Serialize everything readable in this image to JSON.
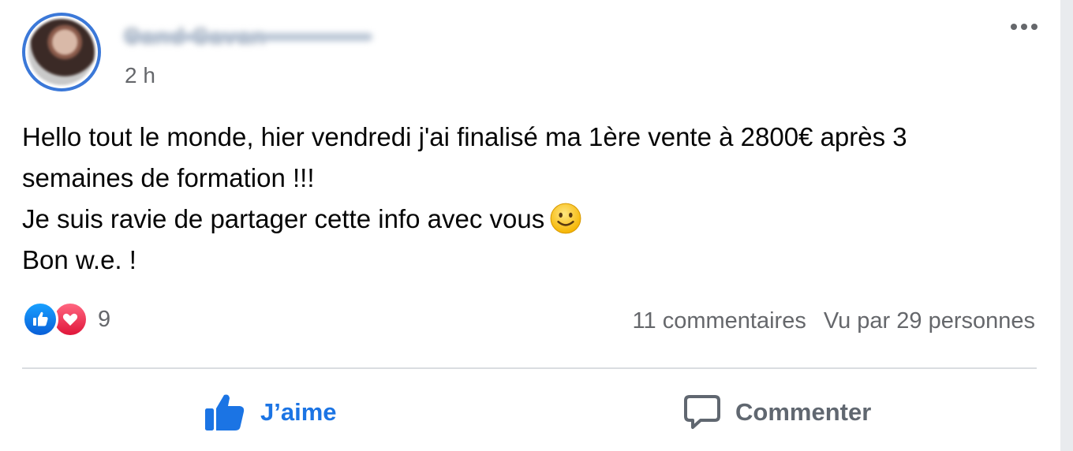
{
  "post": {
    "author_name": "Cand Savan",
    "timestamp": "2 h",
    "text_lines": [
      "Hello tout le monde, hier vendredi j'ai finalisé ma 1ère vente à 2800€ après 3",
      "semaines de formation !!!",
      "Je suis ravie de partager cette info avec vous",
      "Bon w.e. !"
    ],
    "emoji": "slightly-smiling-face-icon"
  },
  "reactions": {
    "types": [
      "like-icon",
      "love-icon"
    ],
    "count": "9",
    "comments": "11 commentaires",
    "views": "Vu par 29 personnes"
  },
  "actions": {
    "like_label": "J’aime",
    "comment_label": "Commenter"
  },
  "colors": {
    "accent": "#1b74e4",
    "avatar_ring": "#3b78d8",
    "secondary_text": "#65676b"
  }
}
